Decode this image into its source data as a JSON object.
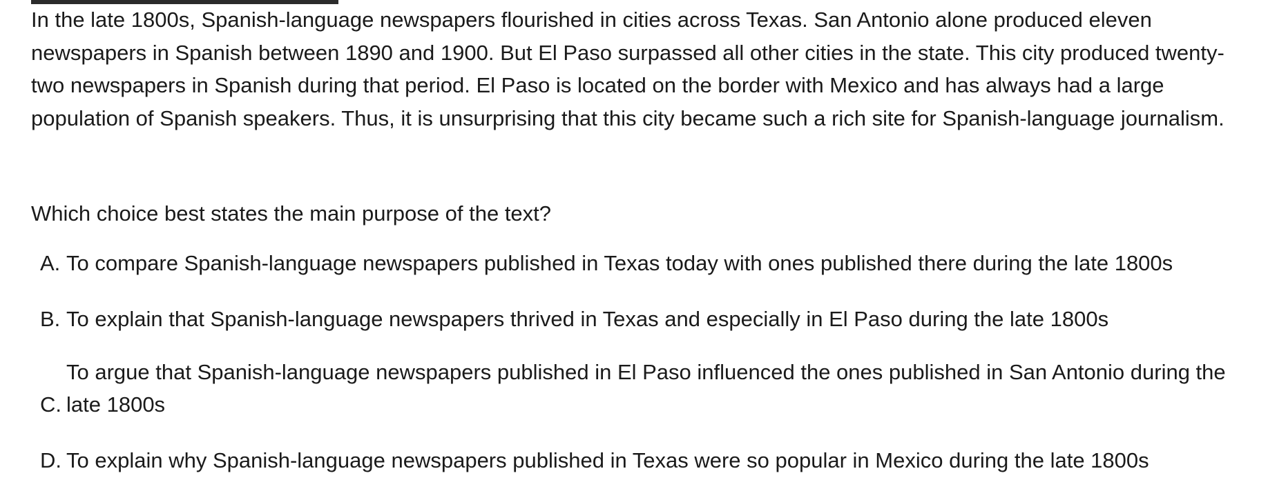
{
  "passage": {
    "text": "In the late 1800s, Spanish-language newspapers flourished in cities across Texas. San Antonio alone produced eleven newspapers in Spanish between 1890 and 1900. But El Paso surpassed all other cities in the state. This city produced twenty-two newspapers in Spanish during that period. El Paso is located on the border with Mexico and has always had a large population of Spanish speakers. Thus, it is unsurprising that this city became such a rich site for Spanish-language journalism."
  },
  "question": {
    "prompt": "Which choice best states the main purpose of the text?"
  },
  "choices": [
    {
      "letter": "A.",
      "text": "To compare Spanish-language newspapers published in Texas today with ones published there during the late 1800s"
    },
    {
      "letter": "B.",
      "text": "To explain that Spanish-language newspapers thrived in Texas and especially in El Paso during the late 1800s"
    },
    {
      "letter": "C.",
      "text": "To argue that Spanish-language newspapers published in El Paso influenced the ones published in San Antonio during the late 1800s"
    },
    {
      "letter": "D.",
      "text": "To explain why Spanish-language newspapers published in Texas were so popular in Mexico during the late 1800s"
    }
  ]
}
